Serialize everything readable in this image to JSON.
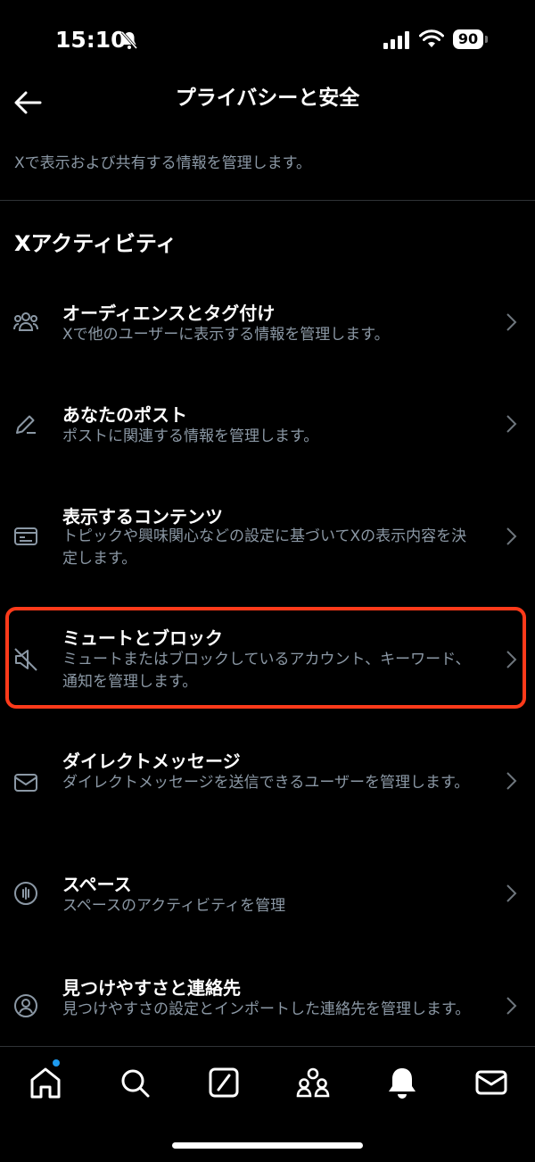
{
  "status": {
    "time": "15:10",
    "battery": "90"
  },
  "header": {
    "title": "プライバシーと安全"
  },
  "intro": {
    "description": "Xで表示および共有する情報を管理します。"
  },
  "section": {
    "title": "Xアクティビティ"
  },
  "items": [
    {
      "icon": "people-icon",
      "title": "オーディエンスとタグ付け",
      "subtitle": "Xで他のユーザーに表示する情報を管理します。"
    },
    {
      "icon": "pencil-icon",
      "title": "あなたのポスト",
      "subtitle": "ポストに関連する情報を管理します。"
    },
    {
      "icon": "content-icon",
      "title": "表示するコンテンツ",
      "subtitle": "トピックや興味関心などの設定に基づいてXの表示内容を決定します。"
    },
    {
      "icon": "mute-icon",
      "title": "ミュートとブロック",
      "subtitle": "ミュートまたはブロックしているアカウント、キーワード、通知を管理します。"
    },
    {
      "icon": "mail-icon",
      "title": "ダイレクトメッセージ",
      "subtitle": "ダイレクトメッセージを送信できるユーザーを管理します。"
    },
    {
      "icon": "spaces-icon",
      "title": "スペース",
      "subtitle": "スペースのアクティビティを管理"
    },
    {
      "icon": "contact-icon",
      "title": "見つけやすさと連絡先",
      "subtitle": "見つけやすさの設定とインポートした連絡先を管理します。"
    }
  ],
  "accent_color": "#1d9bf0",
  "highlight_color": "#ff3a1a"
}
